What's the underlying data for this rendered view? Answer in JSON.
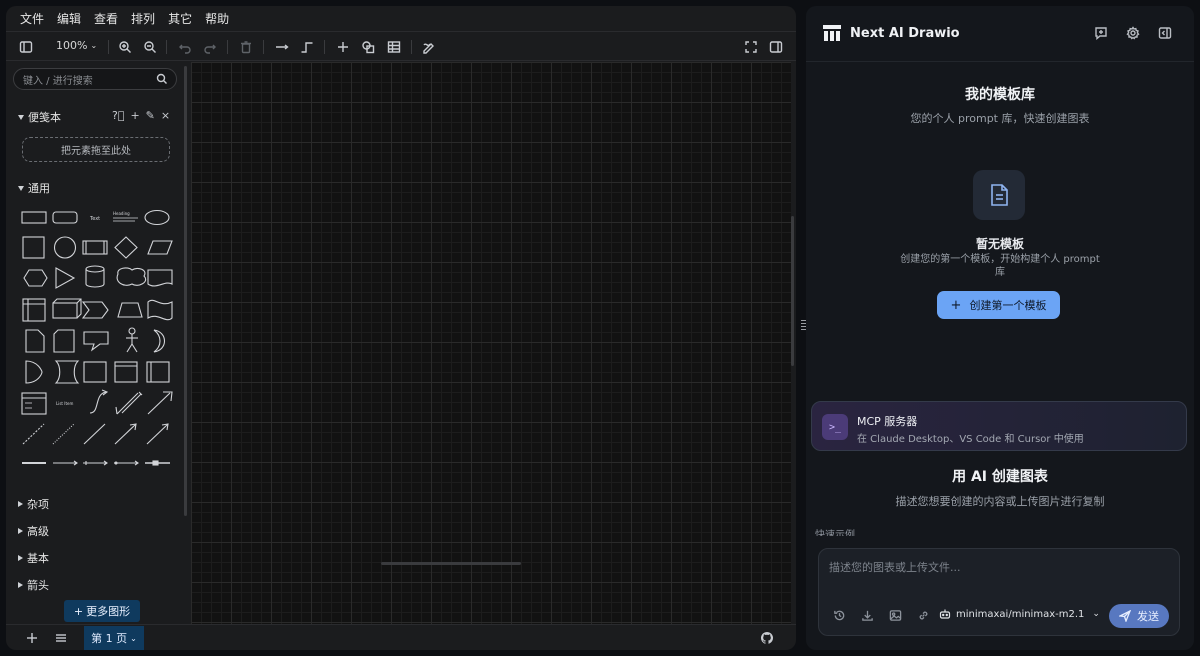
{
  "menu": [
    "文件",
    "编辑",
    "查看",
    "排列",
    "其它",
    "帮助"
  ],
  "toolbar": {
    "zoom": "100%"
  },
  "sidebar": {
    "search_placeholder": "键入 / 进行搜索",
    "scratchpad_title": "便笺本",
    "scratchpad_drop": "把元素拖至此处",
    "general_title": "通用",
    "sections": [
      "杂项",
      "高级",
      "基本",
      "箭头"
    ],
    "more_shapes": "更多图形",
    "shape_text": "Text",
    "shape_heading": "Heading",
    "shape_list_item": "List Item"
  },
  "bottombar": {
    "page_label": "第 1 页"
  },
  "ai": {
    "brand": "Next AI Drawio",
    "library_title": "我的模板库",
    "library_sub": "您的个人 prompt 库，快速创建图表",
    "empty_title": "暂无模板",
    "empty_desc": "创建您的第一个模板，开始构建个人 prompt 库",
    "create_button": "创建第一个模板",
    "mcp_title": "MCP 服务器",
    "mcp_sub": "在 Claude Desktop、VS Code 和 Cursor 中使用",
    "mcp_icon": ">_",
    "create_title": "用 AI 创建图表",
    "create_sub": "描述您想要创建的内容或上传图片进行复制",
    "quick_examples": "快速示例",
    "composer_placeholder": "描述您的图表或上传文件...",
    "model": "minimaxai/minimax-m2.1",
    "send": "发送"
  },
  "colors": {
    "accent_blue": "#6ba4f5",
    "page_tab": "#0f3a5e",
    "send": "#5878c0"
  }
}
